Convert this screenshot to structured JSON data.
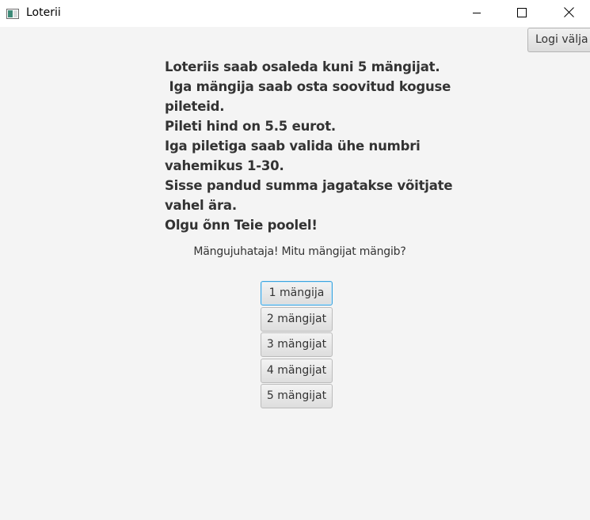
{
  "window": {
    "title": "Loterii"
  },
  "header": {
    "logout_label": "Logi välja"
  },
  "info": {
    "lines": [
      "Loteriis saab osaleda kuni 5 mängijat.",
      " Iga mängija saab osta soovitud koguse",
      "pileteid.",
      "Pileti hind on 5.5 eurot.",
      "Iga piletiga saab valida ühe numbri",
      "vahemikus 1-30.",
      "Sisse pandud summa jagatakse võitjate",
      "vahel ära.",
      "Olgu õnn Teie poolel!"
    ]
  },
  "prompt": {
    "text": "Mängujuhataja! Mitu mängijat mängib?"
  },
  "player_buttons": [
    {
      "label": "1 mängija"
    },
    {
      "label": "2 mängijat"
    },
    {
      "label": "3 mängijat"
    },
    {
      "label": "4 mängijat"
    },
    {
      "label": "5 mängijat"
    }
  ],
  "colors": {
    "background": "#f4f4f4",
    "titlebar": "#ffffff",
    "text": "#333333",
    "focus_border": "#39a3de"
  }
}
